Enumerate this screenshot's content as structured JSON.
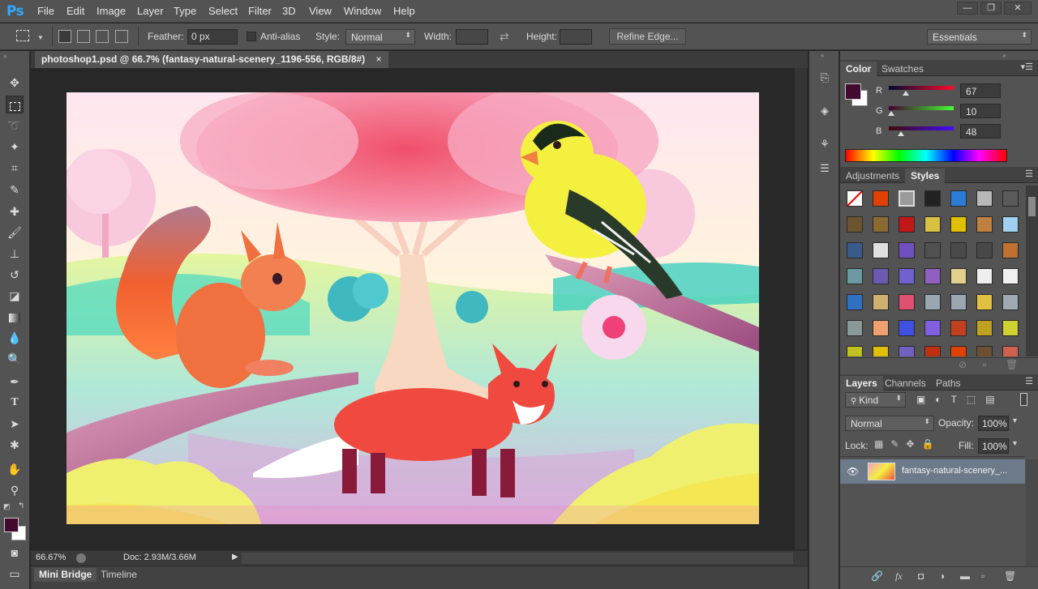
{
  "app": {
    "logo": "Ps"
  },
  "menu": [
    "File",
    "Edit",
    "Image",
    "Layer",
    "Type",
    "Select",
    "Filter",
    "3D",
    "View",
    "Window",
    "Help"
  ],
  "window_controls": {
    "minimize": "—",
    "restore": "❐",
    "close": "✕"
  },
  "options": {
    "feather_label": "Feather:",
    "feather_value": "0 px",
    "antialias_label": "Anti-alias",
    "style_label": "Style:",
    "style_value": "Normal",
    "width_label": "Width:",
    "height_label": "Height:",
    "refine_edge": "Refine Edge...",
    "workspace": "Essentials"
  },
  "document": {
    "tab_title": "photoshop1.psd @ 66.7% (fantasy-natural-scenery_1196-556, RGB/8#)",
    "tab_close": "×",
    "zoom": "66.67%",
    "doc_size": "Doc: 2.93M/3.66M"
  },
  "bottom_tabs": [
    "Mini Bridge",
    "Timeline"
  ],
  "color_panel": {
    "tabs": [
      "Color",
      "Swatches"
    ],
    "foreground_color": "#430a30",
    "channels": [
      {
        "label": "R",
        "value": "67",
        "fraction": 0.26
      },
      {
        "label": "G",
        "value": "10",
        "fraction": 0.04
      },
      {
        "label": "B",
        "value": "48",
        "fraction": 0.19
      }
    ]
  },
  "styles_panel": {
    "tabs": [
      "Adjustments",
      "Styles"
    ],
    "swatch_colors": [
      "#ffffff",
      "#e04000",
      "#9a9a9a",
      "#222222",
      "#2a7cd6",
      "#b8b8b8",
      "#5a5a5a",
      "#6b5430",
      "#8a6a30",
      "#c01818",
      "#d8c040",
      "#e0c000",
      "#c08040",
      "#a0d0f0",
      "#3a5a8a",
      "#e0e0e0",
      "#7050c0",
      "#505050",
      "#4a4a4a",
      "#484848",
      "#c07030",
      "#6a9aa0",
      "#6a5ab0",
      "#7060d0",
      "#9060c0",
      "#e0d090",
      "#eeeeee",
      "#f0f0f0",
      "#3070c0",
      "#d0b070",
      "#e05070",
      "#9aa6b0",
      "#9aa6b0",
      "#e0c040",
      "#a0aab4",
      "#8a9a9a",
      "#f0a070",
      "#4050e0",
      "#8060e0",
      "#c04020",
      "#c0a020",
      "#d0d030",
      "#c0c020",
      "#e0c000",
      "#7060c0",
      "#c03010",
      "#e04000",
      "#6a5030",
      "#d06050"
    ]
  },
  "layers_panel": {
    "tabs": [
      "Layers",
      "Channels",
      "Paths"
    ],
    "filter_kind": "Kind",
    "blend_mode": "Normal",
    "opacity_label": "Opacity:",
    "opacity_value": "100%",
    "lock_label": "Lock:",
    "fill_label": "Fill:",
    "fill_value": "100%",
    "layers": [
      {
        "name": "fantasy-natural-scenery_..."
      }
    ]
  }
}
